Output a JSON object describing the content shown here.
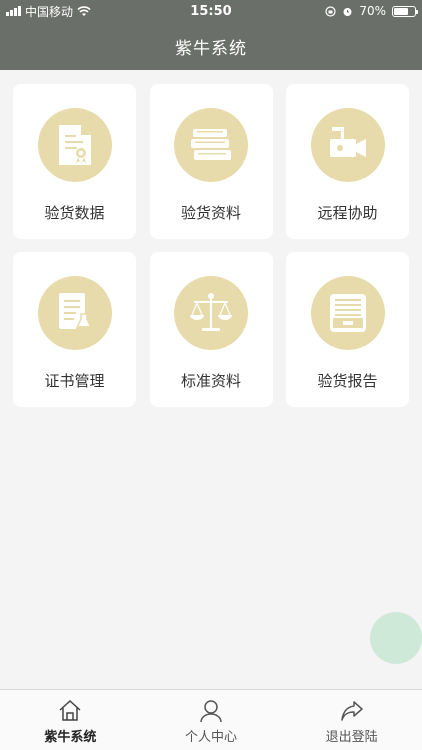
{
  "status_bar": {
    "carrier": "中国移动",
    "time": "15:50",
    "battery_percent": "70%",
    "battery_level": 0.7
  },
  "header": {
    "title": "紫牛系统"
  },
  "grid_items": [
    {
      "label": "验货数据",
      "icon": "certificate-document-icon"
    },
    {
      "label": "验货资料",
      "icon": "books-stack-icon"
    },
    {
      "label": "远程协助",
      "icon": "video-camera-icon"
    },
    {
      "label": "证书管理",
      "icon": "document-flask-icon"
    },
    {
      "label": "标准资料",
      "icon": "balance-scale-icon"
    },
    {
      "label": "验货报告",
      "icon": "file-tray-icon"
    }
  ],
  "tab_bar": {
    "tabs": [
      {
        "label": "紫牛系统",
        "icon": "home-icon",
        "active": true
      },
      {
        "label": "个人中心",
        "icon": "user-icon",
        "active": false
      },
      {
        "label": "退出登陆",
        "icon": "share-arrow-icon",
        "active": false
      }
    ]
  },
  "colors": {
    "header_bg": "#6b6f69",
    "icon_circle": "#e8dbab",
    "fab": "#cfe9d9",
    "background": "#f4f4f4"
  }
}
